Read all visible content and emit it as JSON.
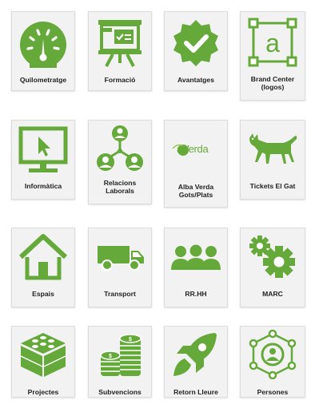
{
  "accent": "#65a93a",
  "tiles": [
    {
      "label": "Quilometratge",
      "icon": "speedometer-icon"
    },
    {
      "label": "Formació",
      "icon": "presentation-board-icon"
    },
    {
      "label": "Avantatges",
      "icon": "badge-check-icon"
    },
    {
      "label": "Brand Center\n(logos)",
      "icon": "brand-frame-icon"
    },
    {
      "label": "Informàtica",
      "icon": "monitor-cursor-icon"
    },
    {
      "label": "Relacions\nLaborals",
      "icon": "people-network-icon"
    },
    {
      "label": "Alba Verda\nGots/Plats",
      "icon": "alba-verda-logo",
      "logo_text": "aVerda"
    },
    {
      "label": "Tickets El Gat",
      "icon": "cat-icon"
    },
    {
      "label": "Espais",
      "icon": "house-icon"
    },
    {
      "label": "Transport",
      "icon": "truck-icon"
    },
    {
      "label": "RR.HH",
      "icon": "people-group-icon"
    },
    {
      "label": "MARC",
      "icon": "gears-icon"
    },
    {
      "label": "Projectes",
      "icon": "blocks-icon"
    },
    {
      "label": "Subvencions",
      "icon": "coin-stacks-icon"
    },
    {
      "label": "Retorn Lleure",
      "icon": "rocket-icon"
    },
    {
      "label": "Persones",
      "icon": "person-network-icon"
    }
  ]
}
